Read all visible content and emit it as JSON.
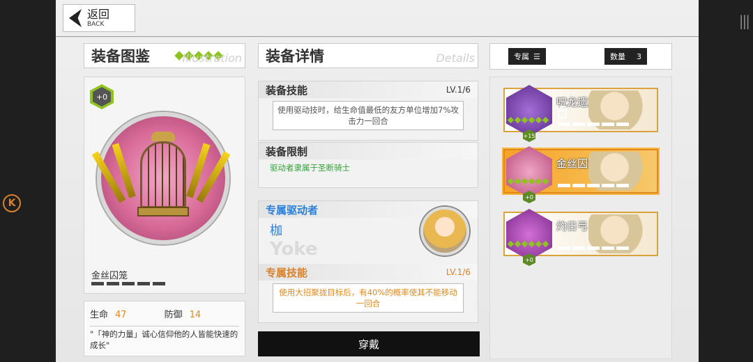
{
  "header": {
    "back_label": "返回",
    "back_sub": "BACK"
  },
  "left_panel": {
    "title": "装备图鉴",
    "ghost_text": "Illustration",
    "plus_level": "+0",
    "item_name": "金丝囚笼",
    "stats": [
      {
        "label": "生命",
        "value": "47"
      },
      {
        "label": "防御",
        "value": "14"
      }
    ],
    "quote": "\"「神的力量」诚心信仰他的人皆能快速的成长\""
  },
  "detail_panel": {
    "title": "装备详情",
    "ghost_text": "Details",
    "skill": {
      "title": "装备技能",
      "level": "LV.1/6",
      "description": "使用驱动技时，给生命值最低的友方单位增加7%攻击力一回合"
    },
    "limit": {
      "title": "装备限制",
      "text": "驱动者隶属于圣断骑士"
    },
    "exclusive_driver": {
      "title": "专属驱动者",
      "name": "枷",
      "name_en": "Yoke"
    },
    "exclusive_skill": {
      "title": "专属技能",
      "level": "LV.1/6",
      "description": "使用大招聚拢目标后，有40%的概率使其不能移动一回合"
    },
    "equip_button": "穿戴"
  },
  "filter": {
    "exclusive_label": "专属",
    "count_label": "数量",
    "count_value": "3"
  },
  "equipment_list": [
    {
      "name": "呪龙遗志",
      "level": "+15",
      "locked": true,
      "selected": false
    },
    {
      "name": "金丝囚笼",
      "level": "+0",
      "locked": false,
      "selected": true
    },
    {
      "name": "灼日弓",
      "level": "+0",
      "locked": false,
      "selected": false
    }
  ],
  "colors": {
    "accent_orange": "#d9822b",
    "accent_green": "#8fc31f",
    "driver_blue": "#2a7fd8"
  }
}
